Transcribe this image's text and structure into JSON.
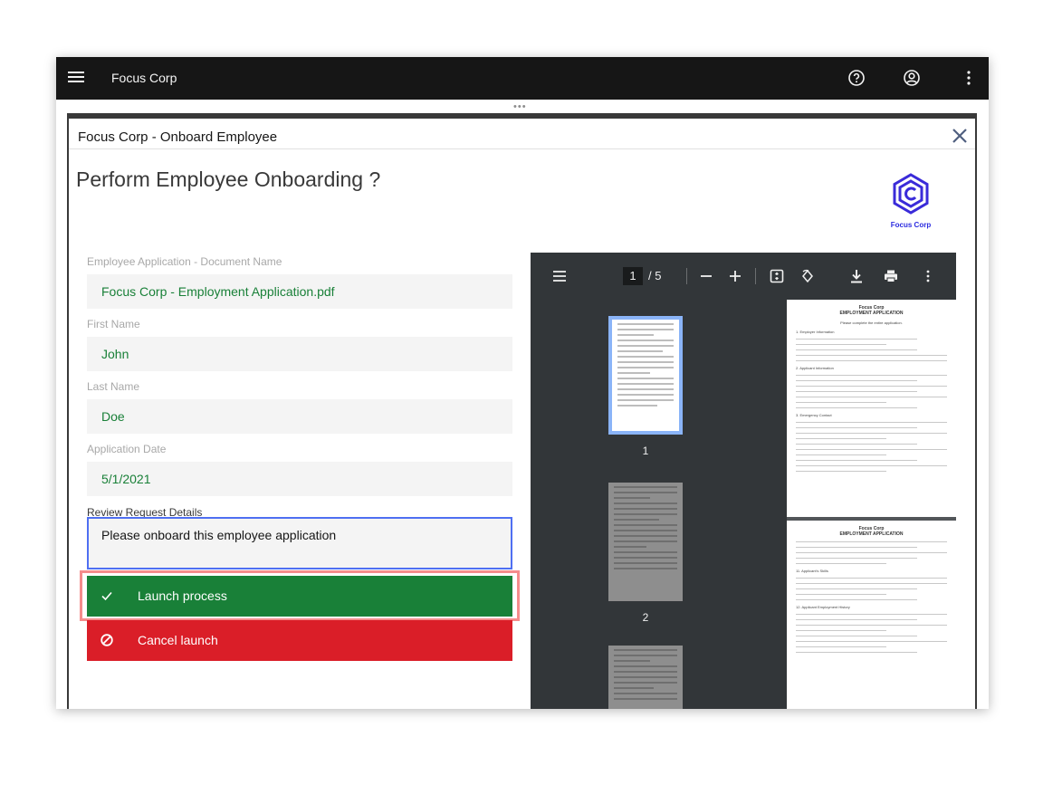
{
  "appbar": {
    "brand": "Focus Corp",
    "icons": [
      "menu-icon",
      "help-icon",
      "user-icon",
      "overflow-menu-icon"
    ]
  },
  "modal": {
    "title": "Focus Corp - Onboard Employee",
    "heading": "Perform Employee Onboarding ?",
    "logo_text": "Focus Corp"
  },
  "form": {
    "document_label": "Employee Application - Document Name",
    "document_value": "Focus Corp - Employment Application.pdf",
    "first_name_label": "First Name",
    "first_name_value": "John",
    "last_name_label": "Last Name",
    "last_name_value": "Doe",
    "date_label": "Application Date",
    "date_value": "5/1/2021",
    "review_label": "Review Request Details",
    "review_value": "Please onboard this employee application"
  },
  "actions": {
    "launch_label": "Launch process",
    "cancel_label": "Cancel launch"
  },
  "viewer": {
    "current_page": "1",
    "total_pages": "/ 5",
    "thumb_numbers": [
      "1",
      "2"
    ],
    "page1_title": "Focus Corp",
    "page1_subtitle": "EMPLOYMENT APPLICATION",
    "page1_intro": "Please complete the entire application.",
    "page1_section": "1.   Employer Information",
    "page1_section2": "2.   Applicant Information",
    "page1_section3": "3.   Emergency Contact",
    "page2_title": "Focus Corp",
    "page2_subtitle": "EMPLOYMENT APPLICATION",
    "page2_section": "11.   Applicant's Skills",
    "page2_section2": "12.   Applicant Employment History"
  }
}
